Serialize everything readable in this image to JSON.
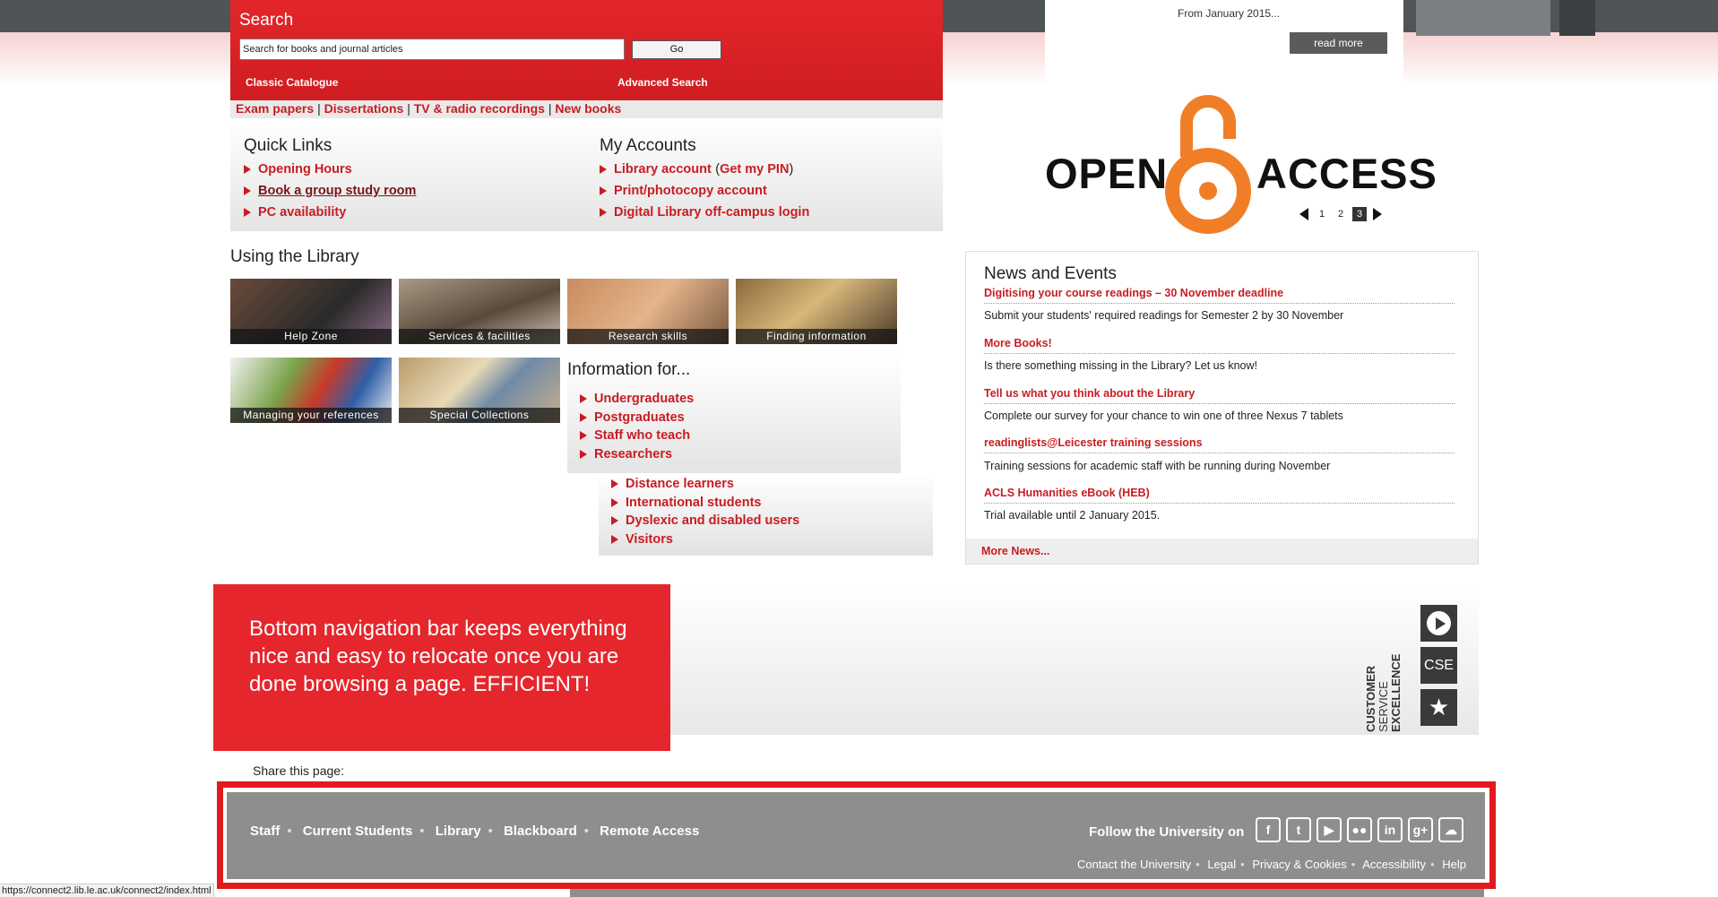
{
  "search": {
    "title": "Search",
    "placeholder": "Search for books and journal articles",
    "go": "Go",
    "classic": "Classic Catalogue",
    "advanced": "Advanced Search"
  },
  "sublinks": [
    "Exam papers",
    "Dissertations",
    "TV & radio recordings",
    "New books"
  ],
  "quick_links": {
    "title": "Quick Links",
    "items": [
      "Opening Hours",
      "Book a group study room",
      "PC availability"
    ]
  },
  "my_accounts": {
    "title": "My Accounts",
    "library_account": "Library account",
    "pin_open": "(",
    "get_pin": "Get my PIN",
    "pin_close": ")",
    "print_account": "Print/photocopy account",
    "digital_login": "Digital Library off-campus login"
  },
  "using": {
    "title": "Using the Library",
    "tiles": [
      "Help Zone",
      "Services & facilities",
      "Research skills",
      "Finding information",
      "Managing your references",
      "Special Collections"
    ]
  },
  "information": {
    "title": "Information for...",
    "primary": [
      "Undergraduates",
      "Postgraduates",
      "Staff who teach",
      "Researchers"
    ],
    "secondary": [
      "Distance learners",
      "International students",
      "Dyslexic and disabled users",
      "Visitors"
    ]
  },
  "promo": {
    "date_text": "From January 2015...",
    "read_more": "read more",
    "open_access_left": "OPEN",
    "open_access_right": "ACCESS",
    "pages": [
      "1",
      "2",
      "3"
    ],
    "current_page": "3"
  },
  "news": {
    "title": "News and Events",
    "items": [
      {
        "headline": "Digitising your course readings – 30 November deadline",
        "text": "Submit your students' required readings for Semester 2 by 30 November"
      },
      {
        "headline": "More Books!",
        "text": "Is there something missing in the Library? Let us know!"
      },
      {
        "headline": "Tell us what you think about the Library",
        "text": "Complete our survey for your chance to win one of three Nexus 7 tablets"
      },
      {
        "headline": "readinglists@Leicester training sessions",
        "text": "Training sessions for academic staff with be running during November"
      },
      {
        "headline": "ACLS Humanities eBook (HEB)",
        "text": "Trial available until 2 January 2015."
      }
    ],
    "more": "More News..."
  },
  "annotation": "Bottom navigation bar keeps everything nice and easy to relocate once you are done browsing a page. EFFICIENT!",
  "cse": {
    "label1": "CUSTOMER",
    "label2": "SERVICE",
    "label3": "EXCELLENCE",
    "badge": "CSE"
  },
  "share": "Share this page:",
  "footer": {
    "nav": [
      "Staff",
      "Current Students",
      "Library",
      "Blackboard",
      "Remote Access"
    ],
    "follow": "Follow the University on",
    "social_icons": [
      "facebook-icon",
      "twitter-icon",
      "youtube-icon",
      "flickr-icon",
      "linkedin-icon",
      "google-plus-icon",
      "soundcloud-icon"
    ],
    "legal": [
      "Contact the University",
      "Legal",
      "Privacy & Cookies",
      "Accessibility",
      "Help"
    ]
  },
  "status_url": "https://connect2.lib.le.ac.uk/connect2/index.html",
  "colors": {
    "brand_red": "#e5262c",
    "link_red": "#c81c22",
    "footer_gray": "#8e8e8e"
  }
}
